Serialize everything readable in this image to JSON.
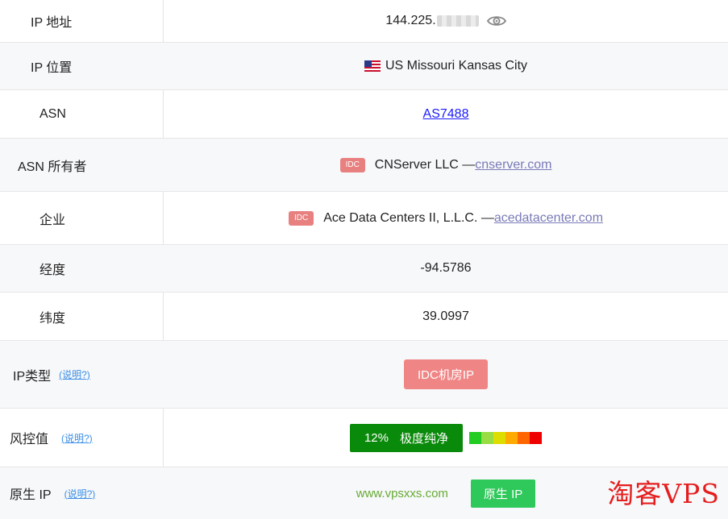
{
  "rows": {
    "ip_address": {
      "label": "IP 地址",
      "value": "144.225."
    },
    "ip_location": {
      "label": "IP 位置",
      "value": "US Missouri Kansas City"
    },
    "asn": {
      "label": "ASN",
      "value": "AS7488"
    },
    "asn_owner": {
      "label": "ASN 所有者",
      "badge": "IDC",
      "name": "CNServer LLC —",
      "domain": "cnserver.com"
    },
    "enterprise": {
      "label": "企业",
      "badge": "IDC",
      "name": "Ace Data Centers II, L.L.C. —",
      "domain": "acedatacenter.com"
    },
    "longitude": {
      "label": "经度",
      "value": "-94.5786"
    },
    "latitude": {
      "label": "纬度",
      "value": "39.0997"
    },
    "ip_type": {
      "label": "IP类型",
      "help": "(说明?)",
      "value": "IDC机房IP"
    },
    "risk": {
      "label": "风控值",
      "help": "(说明?)",
      "percent": "12%",
      "text": "极度纯净",
      "scale_colors": [
        "#22cc22",
        "#99dd44",
        "#dddd00",
        "#ffaa00",
        "#ff6600",
        "#ee0000"
      ]
    },
    "native_ip": {
      "label": "原生 IP",
      "help": "(说明?)",
      "site": "www.vpsxxs.com",
      "value": "原生 IP"
    }
  },
  "watermark": "淘客VPS",
  "icons": {
    "eye": "eye-icon",
    "flag": "us-flag-icon"
  }
}
